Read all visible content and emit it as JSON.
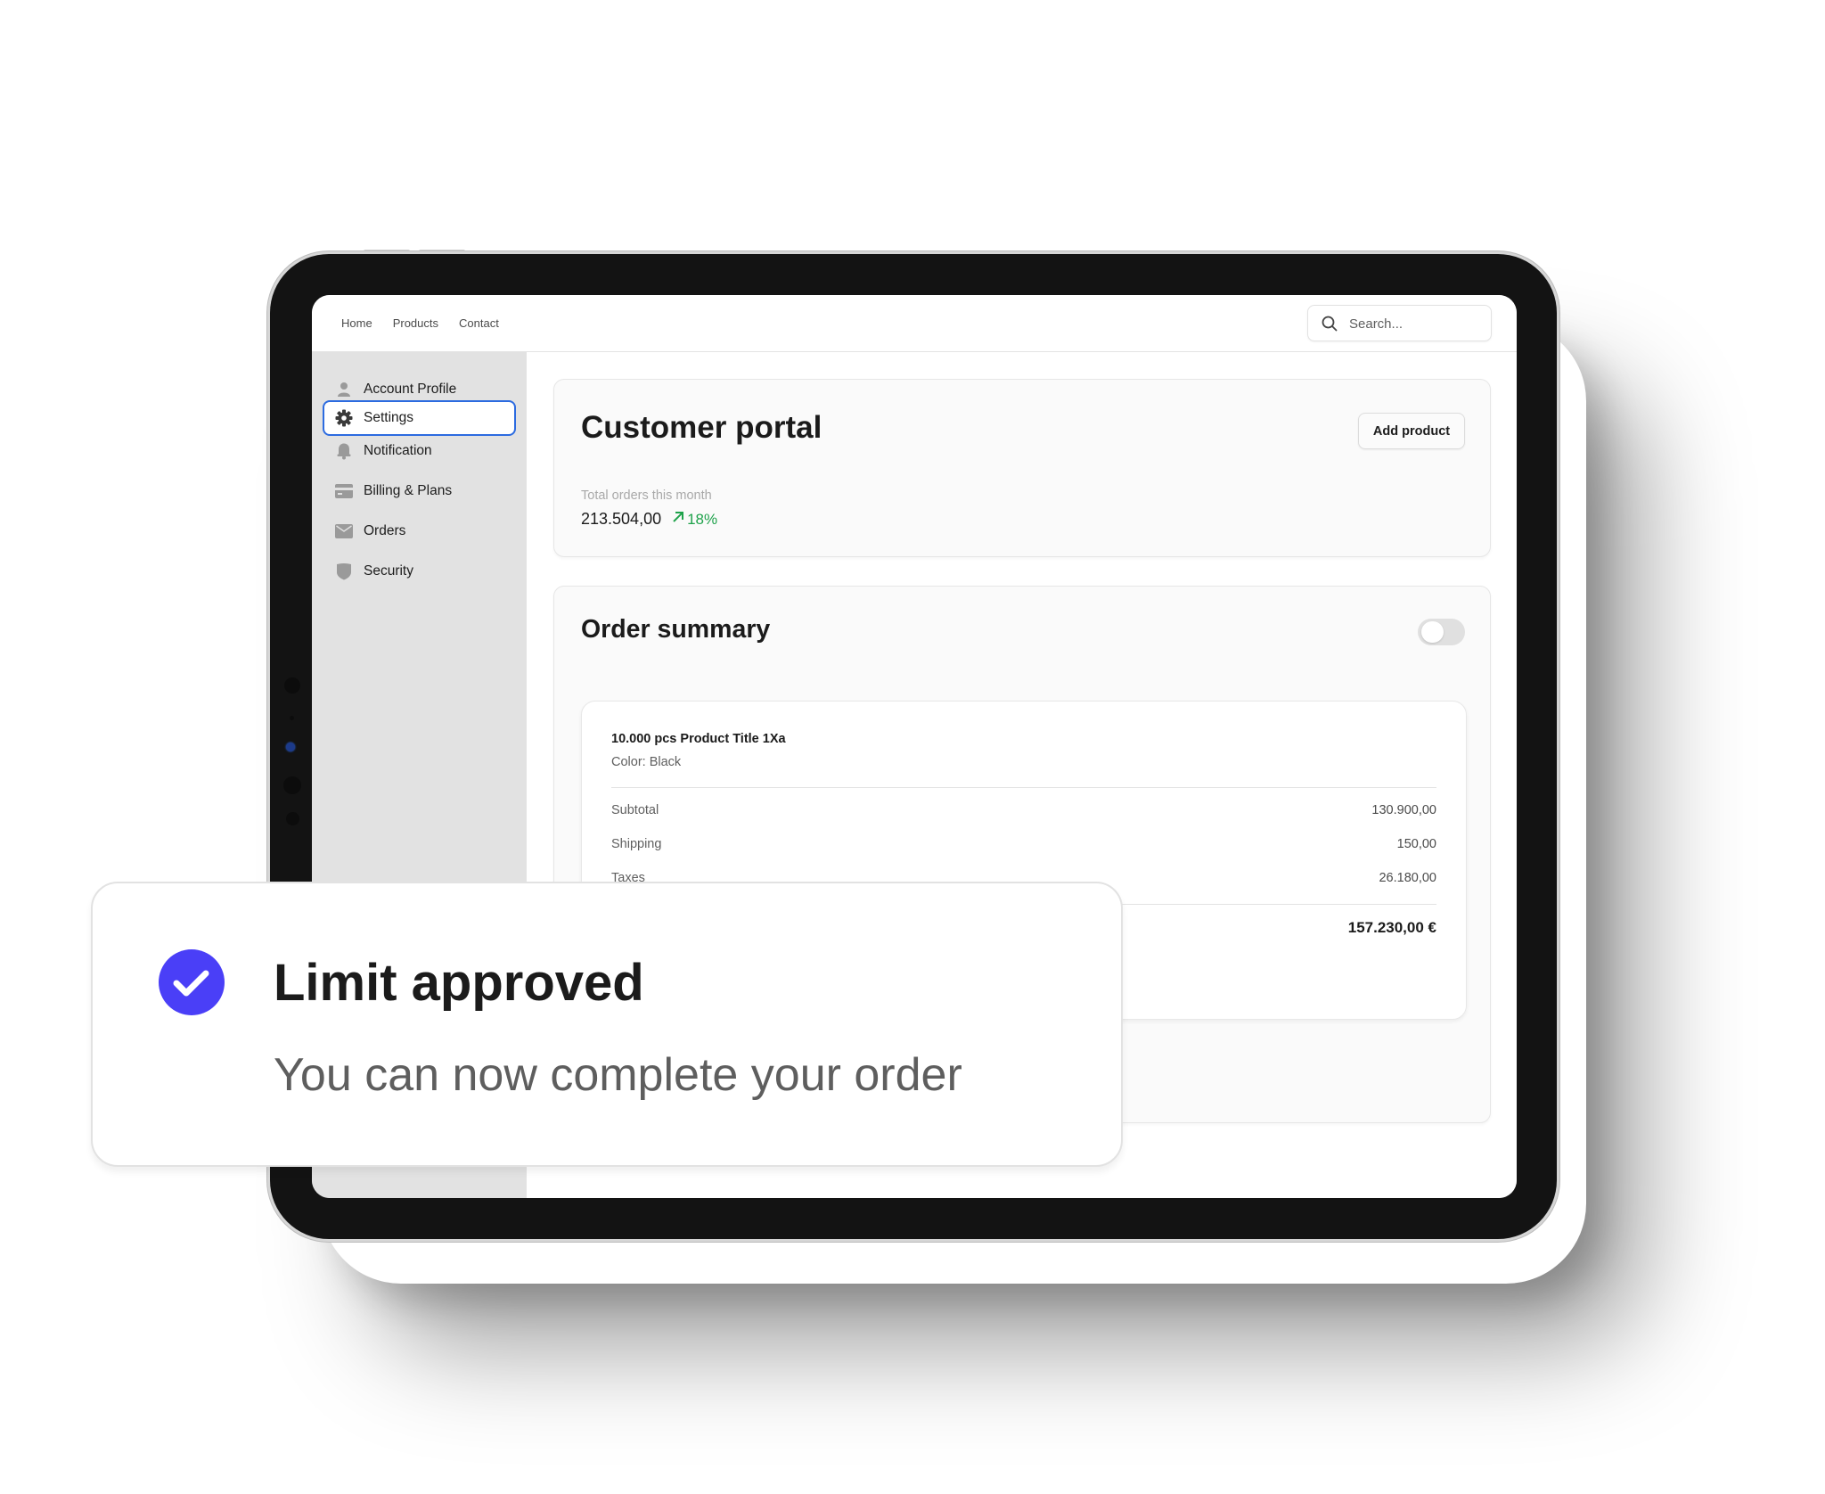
{
  "topnav": {
    "links": [
      "Home",
      "Products",
      "Contact"
    ],
    "search_placeholder": "Search..."
  },
  "sidebar": {
    "items": [
      {
        "label": "Account Profile",
        "icon": "user-icon",
        "active": false
      },
      {
        "label": "Settings",
        "icon": "gear-icon",
        "active": true
      },
      {
        "label": "Notification",
        "icon": "bell-icon",
        "active": false
      },
      {
        "label": "Billing & Plans",
        "icon": "credit-card-icon",
        "active": false
      },
      {
        "label": "Orders",
        "icon": "envelope-icon",
        "active": false
      },
      {
        "label": "Security",
        "icon": "shield-icon",
        "active": false
      }
    ]
  },
  "portal": {
    "title": "Customer portal",
    "add_button": "Add product",
    "stat_label": "Total orders this month",
    "stat_value": "213.504,00",
    "trend_value": "18%",
    "trend_icon": "arrow-up-right-icon"
  },
  "order_summary": {
    "title": "Order summary",
    "toggle_on": false,
    "product_title": "10.000 pcs Product Title 1Xa",
    "product_color": "Color: Black",
    "rows": [
      {
        "label": "Subtotal",
        "value": "130.900,00"
      },
      {
        "label": "Shipping",
        "value": "150,00"
      },
      {
        "label": "Taxes",
        "value": "26.180,00"
      }
    ],
    "total": "157.230,00 €"
  },
  "toast": {
    "title": "Limit approved",
    "message": "You can now complete your order",
    "icon": "check-circle-icon"
  },
  "colors": {
    "accent": "#4a3ff7",
    "selected_outline": "#2c6be0",
    "trend_up": "#1fa24b",
    "sidebar_bg": "#e2e2e2"
  }
}
